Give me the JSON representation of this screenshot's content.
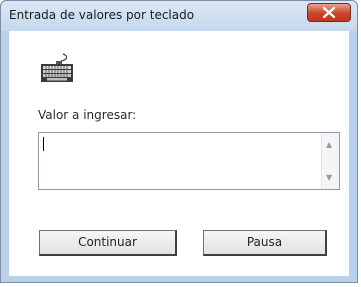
{
  "window": {
    "title": "Entrada de valores por teclado"
  },
  "dialog": {
    "icon": "keyboard-icon",
    "prompt_label": "Valor a ingresar:",
    "input_value": ""
  },
  "buttons": {
    "continue_label": "Continuar",
    "pause_label": "Pausa"
  },
  "colors": {
    "frame": "#b9d1ea",
    "close_button": "#c9452b"
  }
}
